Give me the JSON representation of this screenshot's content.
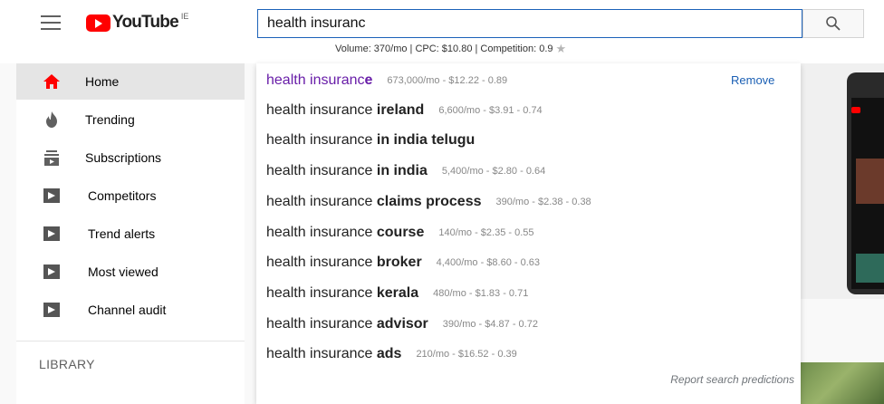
{
  "header": {
    "logo_text": "YouTube",
    "country_code": "IE",
    "search_value": "health insuranc",
    "search_metrics": "Volume: 370/mo | CPC: $10.80 | Competition: 0.9"
  },
  "sidebar": {
    "items": [
      {
        "label": "Home",
        "icon": "home-icon",
        "active": true
      },
      {
        "label": "Trending",
        "icon": "flame-icon"
      },
      {
        "label": "Subscriptions",
        "icon": "subscriptions-icon"
      },
      {
        "label": "Competitors",
        "icon": "play-box-icon"
      },
      {
        "label": "Trend alerts",
        "icon": "play-box-icon"
      },
      {
        "label": "Most viewed",
        "icon": "play-box-icon"
      },
      {
        "label": "Channel audit",
        "icon": "play-box-icon"
      }
    ],
    "section_heading": "LIBRARY"
  },
  "suggestions": [
    {
      "prefix": "health insuranc",
      "suffix": "e",
      "meta": "673,000/mo - $12.22 - 0.89",
      "visited": true
    },
    {
      "prefix": "health insurance",
      "suffix": " ireland",
      "meta": "6,600/mo - $3.91 - 0.74"
    },
    {
      "prefix": "health insurance",
      "suffix": " in india telugu",
      "meta": ""
    },
    {
      "prefix": "health insurance",
      "suffix": " in india",
      "meta": "5,400/mo - $2.80 - 0.64"
    },
    {
      "prefix": "health insurance",
      "suffix": " claims process",
      "meta": "390/mo - $2.38 - 0.38"
    },
    {
      "prefix": "health insurance",
      "suffix": " course",
      "meta": "140/mo - $2.35 - 0.55"
    },
    {
      "prefix": "health insurance",
      "suffix": " broker",
      "meta": "4,400/mo - $8.60 - 0.63"
    },
    {
      "prefix": "health insurance",
      "suffix": " kerala",
      "meta": "480/mo - $1.83 - 0.71"
    },
    {
      "prefix": "health insurance",
      "suffix": " advisor",
      "meta": "390/mo - $4.87 - 0.72"
    },
    {
      "prefix": "health insurance",
      "suffix": " ads",
      "meta": "210/mo - $16.52 - 0.39"
    }
  ],
  "dropdown": {
    "remove_label": "Remove",
    "report_label": "Report search predictions"
  },
  "colors": {
    "brand_red": "#ff0000",
    "link_blue": "#1a5fb4",
    "visited_purple": "#681da8",
    "active_bg": "#e5e5e5"
  }
}
